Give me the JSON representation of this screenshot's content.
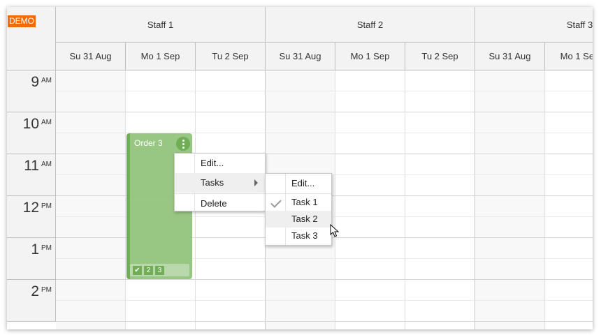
{
  "demo_badge": "DEMO",
  "groups": [
    {
      "name": "Staff 1"
    },
    {
      "name": "Staff 2"
    },
    {
      "name": "Staff 3"
    }
  ],
  "days": [
    "Su 31 Aug",
    "Mo 1 Sep",
    "Tu 2 Sep"
  ],
  "hours": [
    {
      "hour": "9",
      "ampm": "AM"
    },
    {
      "hour": "10",
      "ampm": "AM"
    },
    {
      "hour": "11",
      "ampm": "AM"
    },
    {
      "hour": "12",
      "ampm": "PM"
    },
    {
      "hour": "1",
      "ampm": "PM"
    },
    {
      "hour": "2",
      "ampm": "PM"
    }
  ],
  "event": {
    "title": "Order 3",
    "tasks": [
      {
        "label": "✔",
        "done": true
      },
      {
        "label": "2",
        "done": false
      },
      {
        "label": "3",
        "done": false
      }
    ],
    "color": "#93c47d",
    "bar_color": "#6aa84f"
  },
  "context_menu": {
    "items": [
      "Edit...",
      "Tasks",
      "Delete"
    ]
  },
  "tasks_submenu": {
    "items": [
      "Edit...",
      "Task 1",
      "Task 2",
      "Task 3"
    ],
    "checked": "Task 1",
    "hovered": "Task 2"
  },
  "colors": {
    "header_bg": "#f3f3f3",
    "demo_bg": "#f36b00"
  }
}
